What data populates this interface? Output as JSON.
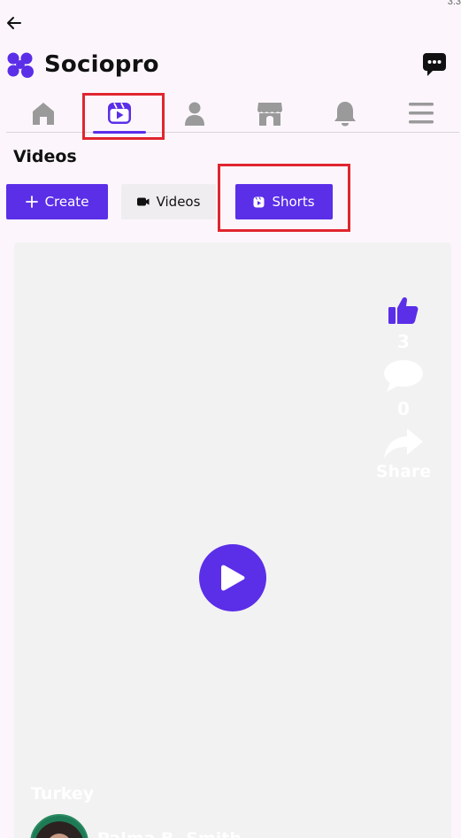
{
  "status": {
    "corner_text": "3:3"
  },
  "header": {
    "brand_name": "Sociopro",
    "brand_color": "#5b2ee8",
    "back_icon": "arrow-left-icon",
    "chat_icon": "chat-bubble-icon"
  },
  "nav": {
    "items": [
      {
        "name": "home",
        "icon": "home-icon",
        "active": false
      },
      {
        "name": "videos",
        "icon": "video-reel-icon",
        "active": true
      },
      {
        "name": "profile",
        "icon": "user-icon",
        "active": false
      },
      {
        "name": "marketplace",
        "icon": "store-icon",
        "active": false
      },
      {
        "name": "notifications",
        "icon": "bell-icon",
        "active": false
      },
      {
        "name": "menu",
        "icon": "hamburger-menu-icon",
        "active": false
      }
    ]
  },
  "page": {
    "title": "Videos",
    "buttons": {
      "create": "Create",
      "videos": "Videos",
      "shorts": "Shorts"
    }
  },
  "video": {
    "likes": "3",
    "comments": "0",
    "share_label": "Share",
    "location": "Turkey",
    "author": "Palma B. Smith"
  },
  "colors": {
    "accent": "#5b2ee8",
    "highlight": "#e0262f",
    "inactive_icon": "#9a9a9a"
  }
}
